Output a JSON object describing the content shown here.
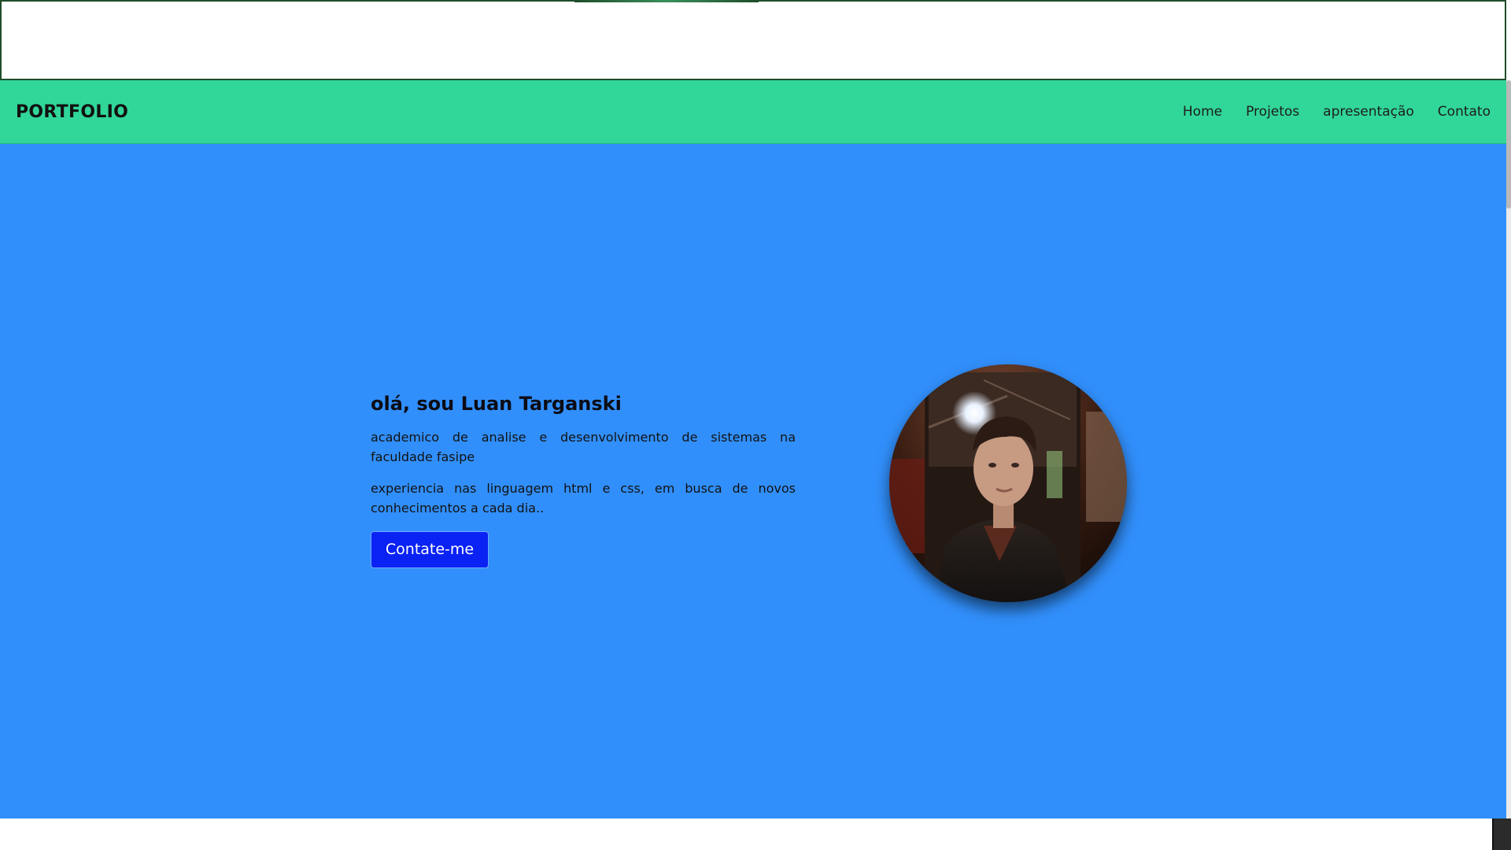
{
  "navbar": {
    "brand": "PORTFOLIO",
    "links": [
      "Home",
      "Projetos",
      "apresentação",
      "Contato"
    ]
  },
  "hero": {
    "title": "olá, sou Luan Targanski",
    "paragraphs": [
      "academico de analise e desenvolvimento de sistemas na faculdade fasipe",
      "experiencia nas linguagem html e css, em busca de novos conhecimentos a cada dia.."
    ],
    "cta_label": "Contate-me"
  },
  "colors": {
    "navbar_bg": "#31d699",
    "hero_bg": "#318ffb",
    "cta_bg": "#0a22f4"
  },
  "icons": {
    "profile_photo": "portrait-photo"
  }
}
